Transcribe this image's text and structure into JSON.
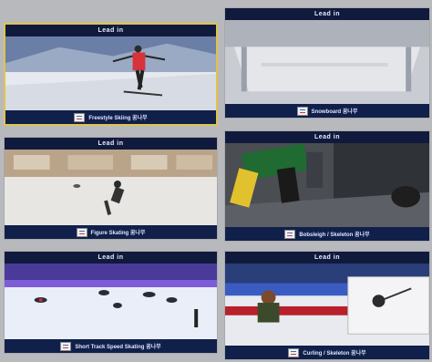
{
  "tiles": [
    {
      "header": "Lead in",
      "caption": "Freestyle Skiing 꿈나무",
      "scene": "skier-on-slope",
      "selected": true
    },
    {
      "header": "Lead in",
      "caption": "Snowboard 꿈나무",
      "scene": "empty-halfpipe",
      "selected": false
    },
    {
      "header": "Lead in",
      "caption": "Figure Skating 꿈나무",
      "scene": "skater-on-rink",
      "selected": false
    },
    {
      "header": "Lead in",
      "caption": "Bobsleigh / Skeleton 꿈나무",
      "scene": "sled-push-start",
      "selected": false
    },
    {
      "header": "Lead in",
      "caption": "Short Track Speed Skating 꿈나무",
      "scene": "short-track-race",
      "selected": false
    },
    {
      "header": "Lead in",
      "caption": "Curling / Skeleton 꿈나무",
      "scene": "curling-athlete",
      "selected": false
    }
  ],
  "colors": {
    "header_bg": "#101a3c",
    "caption_bg": "#10204a",
    "selected_border": "#e0c44a",
    "page_bg": "#b8b9bd"
  }
}
